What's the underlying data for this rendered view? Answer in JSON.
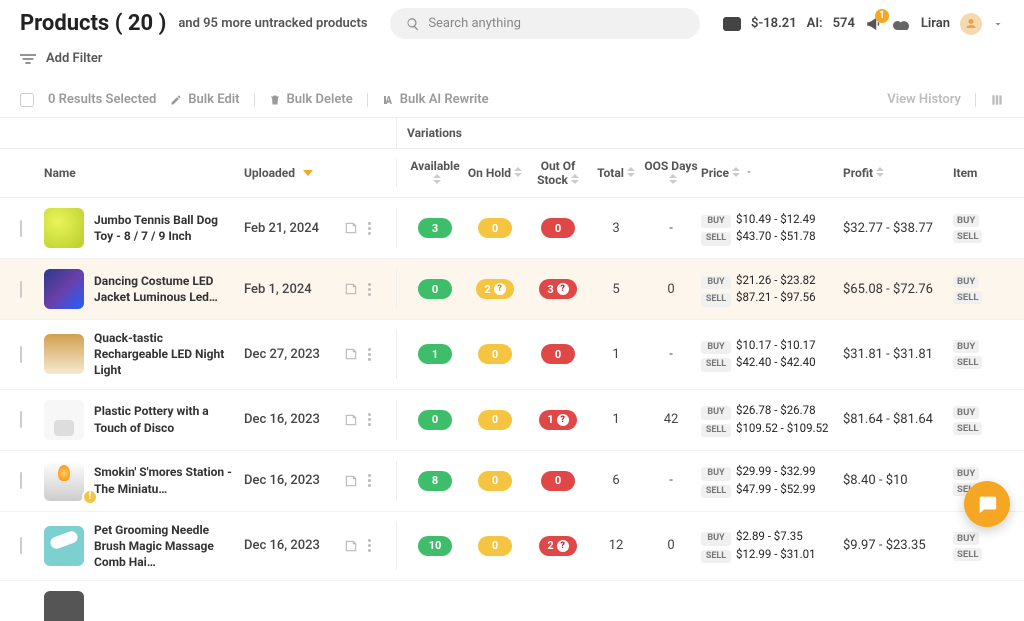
{
  "header": {
    "title_prefix": "Products",
    "title_count": "( 20 )",
    "subtitle": "and 95 more untracked products",
    "search_placeholder": "Search anything",
    "balance": "$-18.21",
    "ai_label": "AI:",
    "ai_value": "574",
    "notif_count": "1",
    "username": "Liran"
  },
  "filter": {
    "add_filter": "Add Filter"
  },
  "toolbar": {
    "results_selected": "0 Results Selected",
    "bulk_edit": "Bulk Edit",
    "bulk_delete": "Bulk Delete",
    "bulk_ai": "Bulk AI Rewrite",
    "view_history": "View History"
  },
  "columns": {
    "variations": "Variations",
    "name": "Name",
    "uploaded": "Uploaded",
    "available": "Available",
    "on_hold": "On Hold",
    "out_of_stock": "Out Of Stock",
    "total": "Total",
    "oos_days": "OOS Days",
    "price": "Price",
    "profit": "Profit",
    "item": "Item"
  },
  "tags": {
    "buy": "BUY",
    "sell": "SELL"
  },
  "item_tags": {
    "buy": "BUY",
    "sell": "SELL"
  },
  "rows": [
    {
      "name": "Jumbo Tennis Ball Dog Toy - 8 / 7 / 9 Inch",
      "uploaded": "Feb 21, 2024",
      "available": "3",
      "hold": "0",
      "oos": "0",
      "total": "3",
      "oos_days": "-",
      "buy": "$10.49 - $12.49",
      "sell": "$43.70 - $51.78",
      "profit": "$32.77 - $38.77",
      "thumb": "ball",
      "highlight": false,
      "hold_warn": false,
      "oos_warn": false,
      "row_alert": false
    },
    {
      "name": "Dancing Costume LED Jacket Luminous Led…",
      "uploaded": "Feb 1, 2024",
      "available": "0",
      "hold": "2",
      "oos": "3",
      "total": "5",
      "oos_days": "0",
      "buy": "$21.26 - $23.82",
      "sell": "$87.21 - $97.56",
      "profit": "$65.08 - $72.76",
      "thumb": "led",
      "highlight": true,
      "hold_warn": true,
      "oos_warn": true,
      "row_alert": false
    },
    {
      "name": "Quack-tastic Rechargeable LED Night Light",
      "uploaded": "Dec 27, 2023",
      "available": "1",
      "hold": "0",
      "oos": "0",
      "total": "1",
      "oos_days": "-",
      "buy": "$10.17 - $10.17",
      "sell": "$42.40 - $42.40",
      "profit": "$31.81 - $31.81",
      "thumb": "quack",
      "highlight": false,
      "hold_warn": false,
      "oos_warn": false,
      "row_alert": false
    },
    {
      "name": "Plastic Pottery with a Touch of Disco",
      "uploaded": "Dec 16, 2023",
      "available": "0",
      "hold": "0",
      "oos": "1",
      "total": "1",
      "oos_days": "42",
      "buy": "$26.78 - $26.78",
      "sell": "$109.52 - $109.52",
      "profit": "$81.64 - $81.64",
      "thumb": "pot",
      "highlight": false,
      "hold_warn": false,
      "oos_warn": true,
      "row_alert": false
    },
    {
      "name": "Smokin' S'mores Station - The Miniatu…",
      "uploaded": "Dec 16, 2023",
      "available": "8",
      "hold": "0",
      "oos": "0",
      "total": "6",
      "oos_days": "-",
      "buy": "$29.99 - $32.99",
      "sell": "$47.99 - $52.99",
      "profit": "$8.40 - $10",
      "thumb": "smoke",
      "highlight": false,
      "hold_warn": false,
      "oos_warn": false,
      "row_alert": true
    },
    {
      "name": "Pet Grooming Needle Brush Magic Massage Comb Hai…",
      "uploaded": "Dec 16, 2023",
      "available": "10",
      "hold": "0",
      "oos": "2",
      "total": "12",
      "oos_days": "0",
      "buy": "$2.89 - $7.35",
      "sell": "$12.99 - $31.01",
      "profit": "$9.97 - $23.35",
      "thumb": "pet",
      "highlight": false,
      "hold_warn": false,
      "oos_warn": true,
      "row_alert": false
    }
  ]
}
